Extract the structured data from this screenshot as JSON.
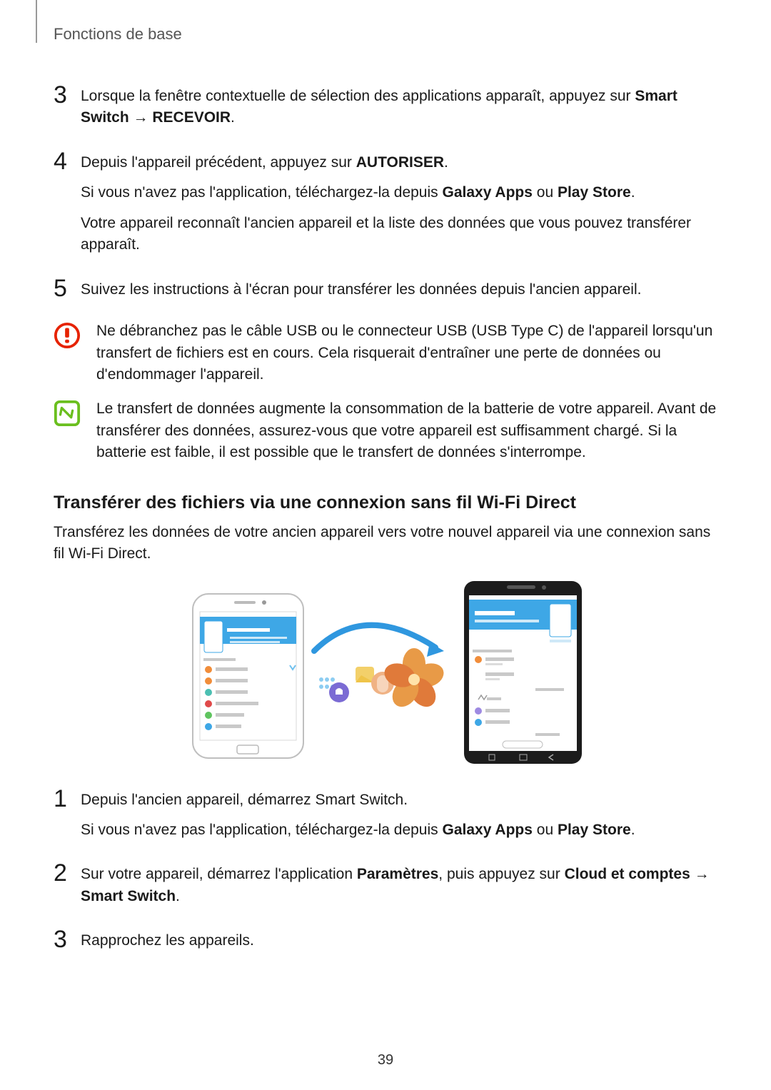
{
  "section_header": "Fonctions de base",
  "steps_a": {
    "step3": {
      "num": "3",
      "text_before": "Lorsque la fenêtre contextuelle de sélection des applications apparaît, appuyez sur ",
      "bold1": "Smart Switch",
      "arrow": " → ",
      "bold2": "RECEVOIR",
      "period": "."
    },
    "step4": {
      "num": "4",
      "line1_before": "Depuis l'appareil précédent, appuyez sur ",
      "line1_bold": "AUTORISER",
      "line1_after": ".",
      "line2_before": "Si vous n'avez pas l'application, téléchargez-la depuis ",
      "line2_bold1": "Galaxy Apps",
      "line2_mid": " ou ",
      "line2_bold2": "Play Store",
      "line2_after": ".",
      "line3": "Votre appareil reconnaît l'ancien appareil et la liste des données que vous pouvez transférer apparaît."
    },
    "step5": {
      "num": "5",
      "text": "Suivez les instructions à l'écran pour transférer les données depuis l'ancien appareil."
    }
  },
  "callout_warn": {
    "text": "Ne débranchez pas le câble USB ou le connecteur USB (USB Type C) de l'appareil lorsqu'un transfert de fichiers est en cours. Cela risquerait d'entraîner une perte de données ou d'endommager l'appareil."
  },
  "callout_note": {
    "text": "Le transfert de données augmente la consommation de la batterie de votre appareil. Avant de transférer des données, assurez-vous que votre appareil est suffisamment chargé. Si la batterie est faible, il est possible que le transfert de données s'interrompe."
  },
  "subheading": "Transférer des fichiers via une connexion sans fil Wi-Fi Direct",
  "intro": "Transférez les données de votre ancien appareil vers votre nouvel appareil via une connexion sans fil Wi-Fi Direct.",
  "steps_b": {
    "step1": {
      "num": "1",
      "line1": "Depuis l'ancien appareil, démarrez Smart Switch.",
      "line2_before": "Si vous n'avez pas l'application, téléchargez-la depuis ",
      "line2_bold1": "Galaxy Apps",
      "line2_mid": " ou ",
      "line2_bold2": "Play Store",
      "line2_after": "."
    },
    "step2": {
      "num": "2",
      "text_before": "Sur votre appareil, démarrez l'application ",
      "bold1": "Paramètres",
      "text_mid1": ", puis appuyez sur ",
      "bold2": "Cloud et comptes",
      "arrow": " → ",
      "bold3": "Smart Switch",
      "period": "."
    },
    "step3": {
      "num": "3",
      "text": "Rapprochez les appareils."
    }
  },
  "page_number": "39"
}
